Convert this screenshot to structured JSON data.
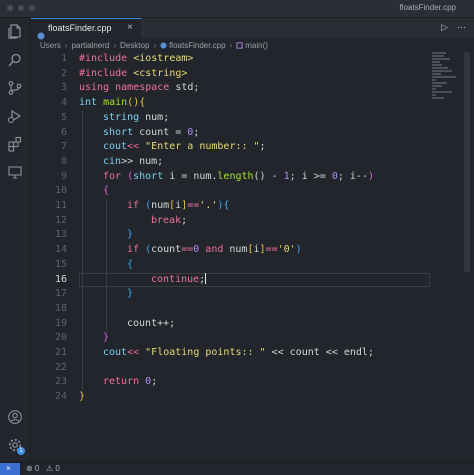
{
  "window": {
    "title": "floatsFinder.cpp"
  },
  "tab": {
    "label": "floatsFinder.cpp",
    "close": "×"
  },
  "tab_actions": {
    "run": "▷",
    "more": "⋯"
  },
  "breadcrumb": [
    "Users",
    "partialnerd",
    "Desktop",
    "floatsFinder.cpp",
    "main()"
  ],
  "editor": {
    "active_line": 16,
    "line_numbers": [
      "1",
      "2",
      "3",
      "4",
      "5",
      "6",
      "7",
      "8",
      "9",
      "10",
      "11",
      "12",
      "13",
      "14",
      "15",
      "16",
      "17",
      "18",
      "19",
      "20",
      "21",
      "22",
      "23",
      "24"
    ]
  },
  "code": {
    "l1": [
      "#include",
      " <iostream>"
    ],
    "l2": [
      "#include",
      " <cstring>"
    ],
    "l3": [
      "using",
      " namespace",
      " std;"
    ],
    "l4": [
      "int",
      " main",
      "()",
      "{"
    ],
    "l5": [
      "string",
      " num;"
    ],
    "l6": [
      "short",
      " count = ",
      "0",
      ";"
    ],
    "l7": [
      "cout",
      "<< ",
      "\"Enter a number:: \"",
      ";"
    ],
    "l8": [
      "cin",
      ">> num;"
    ],
    "l9": [
      "for",
      " (",
      "short",
      " i = num.",
      "length",
      "() - ",
      "1",
      "; i >= ",
      "0",
      "; i--",
      ")"
    ],
    "l10": [
      "{"
    ],
    "l11": [
      "if",
      " (",
      "num",
      "[",
      "i",
      "]",
      "==",
      "'.'",
      ")",
      "{"
    ],
    "l12": [
      "break",
      ";"
    ],
    "l13": [
      "}"
    ],
    "l14": [
      "if",
      " (",
      "count",
      "==",
      "0",
      " and ",
      "num",
      "[",
      "i",
      "]",
      "==",
      "'0'",
      ")"
    ],
    "l15": [
      "{"
    ],
    "l16": [
      "continue",
      ";"
    ],
    "l17": [
      "}"
    ],
    "l18": [
      ""
    ],
    "l19": [
      "count++;"
    ],
    "l20": [
      "}"
    ],
    "l21": [
      "cout",
      "<< ",
      "\"Floating points:: \"",
      " << count << endl;"
    ],
    "l22": [
      ""
    ],
    "l23": [
      "return",
      " ",
      "0",
      ";"
    ],
    "l24": [
      "}"
    ]
  },
  "status": {
    "remote": "×",
    "errors": "⊗ 0",
    "warnings": "⚠ 0",
    "badge": "1"
  },
  "colors": {
    "accent": "#3b8eea",
    "keyword": "#f0719b",
    "type": "#7ccff0",
    "string": "#e6db74",
    "number": "#b48ef0"
  }
}
